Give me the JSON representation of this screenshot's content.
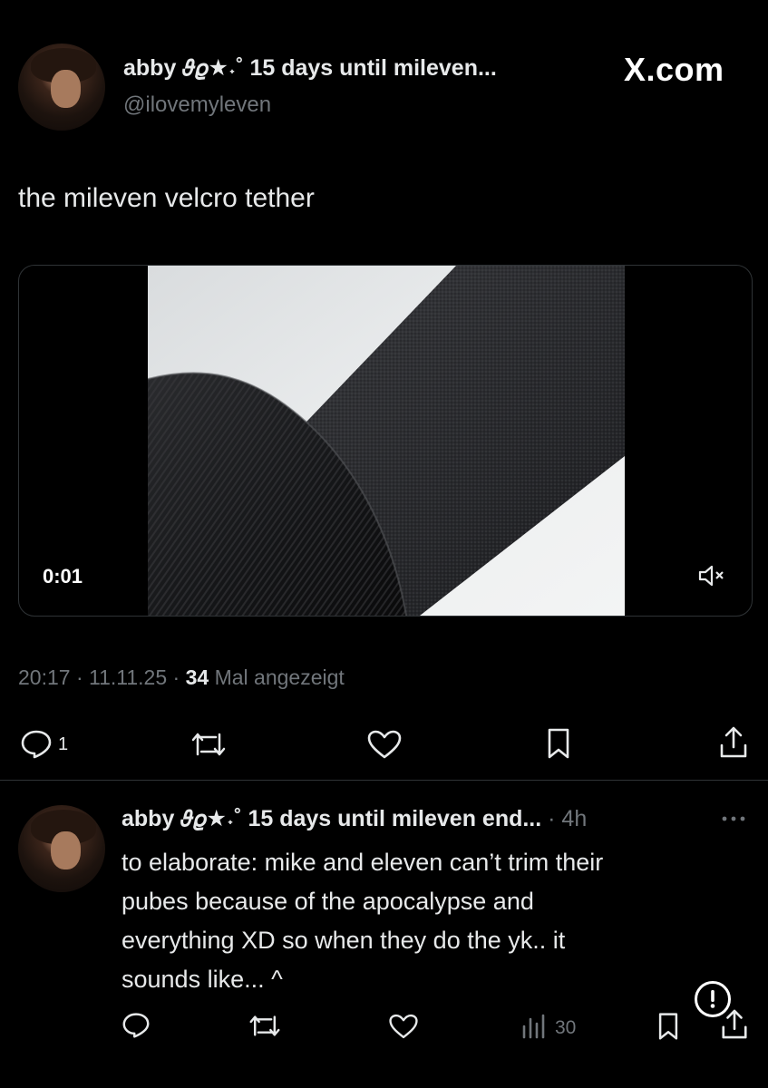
{
  "header": {
    "display_name": "abby 𝜗𝜚★˖˚ 15 days until mileven...",
    "handle": "@ilovemyleven",
    "site_label": "X.com"
  },
  "post": {
    "text": "the mileven velcro tether",
    "video_time": "0:01",
    "time": "20:17",
    "date": "11.11.25",
    "views_count": "34",
    "views_label": "Mal angezeigt",
    "reply_count": "1"
  },
  "reply": {
    "display_name": "abby 𝜗𝜚★˖˚ 15 days until mileven end...",
    "age": "4h",
    "text_lines": [
      "to elaborate: mike and eleven can’t trim their",
      "pubes because of the apocalypse and",
      "everything XD so when they do the yk.. it",
      "sounds like... ^"
    ],
    "views_count": "30"
  },
  "icons": {
    "reply": "speech-bubble-icon",
    "repost": "repost-arrows-icon",
    "like": "heart-icon",
    "bookmark": "bookmark-icon",
    "share": "share-icon",
    "views": "bar-chart-icon",
    "more": "more-dots-icon",
    "mute": "speaker-muted-icon",
    "info": "exclamation-circle-icon"
  },
  "colors": {
    "background": "#000000",
    "text": "#e7e9ea",
    "muted": "#71767b"
  }
}
